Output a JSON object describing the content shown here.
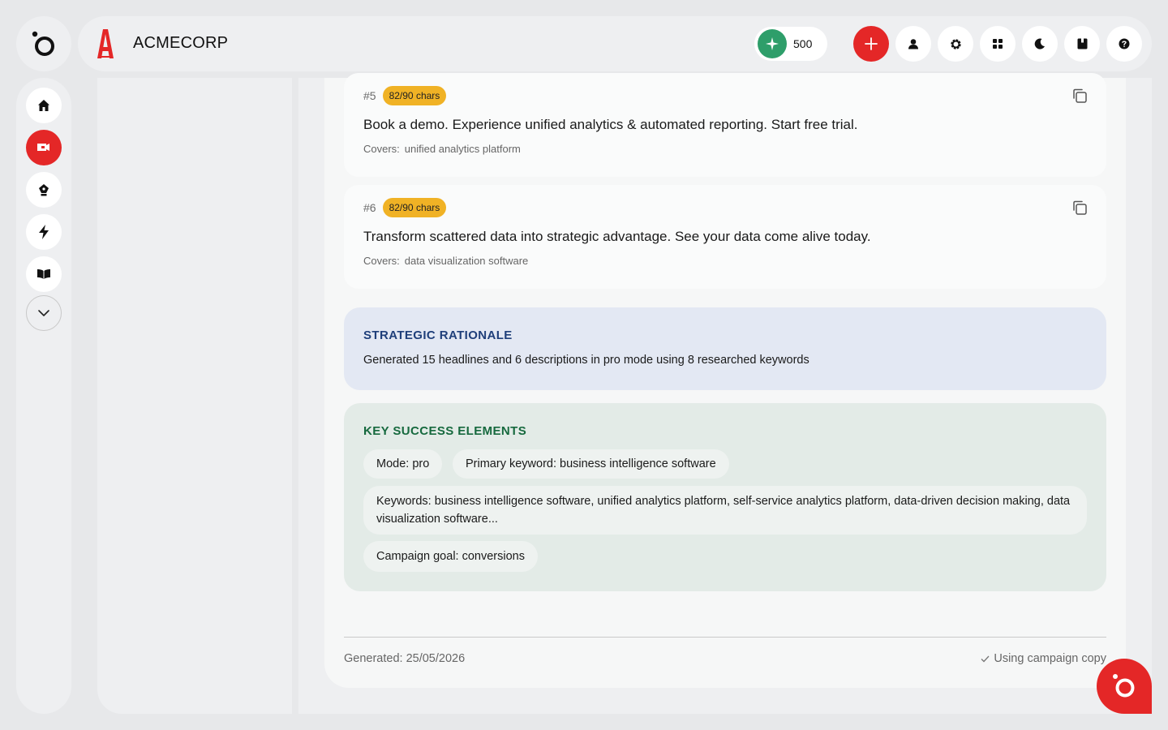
{
  "header": {
    "brand_name": "ACMECORP",
    "credits": "500"
  },
  "descriptions": [
    {
      "number": "#5",
      "chars": "82/90 chars",
      "text": "Book a demo. Experience unified analytics & automated reporting. Start free trial.",
      "covers_label": "Covers:",
      "covers_value": "unified analytics platform"
    },
    {
      "number": "#6",
      "chars": "82/90 chars",
      "text": "Transform scattered data into strategic advantage. See your data come alive today.",
      "covers_label": "Covers:",
      "covers_value": "data visualization software"
    }
  ],
  "rationale": {
    "title": "STRATEGIC RATIONALE",
    "text": "Generated 15 headlines and 6 descriptions in pro mode using 8 researched keywords"
  },
  "success": {
    "title": "KEY SUCCESS ELEMENTS",
    "chips": [
      "Mode: pro",
      "Primary keyword: business intelligence software",
      "Keywords: business intelligence software, unified analytics platform, self-service analytics platform, data-driven decision making, data visualization software...",
      "Campaign goal: conversions"
    ]
  },
  "footer": {
    "generated": "Generated: 25/05/2026",
    "status": "Using campaign copy"
  },
  "colors": {
    "accent": "#e42727",
    "credits": "#2e9e6a",
    "badge": "#f0b225",
    "rationale_title": "#1f3f7a",
    "success_title": "#16693e"
  }
}
